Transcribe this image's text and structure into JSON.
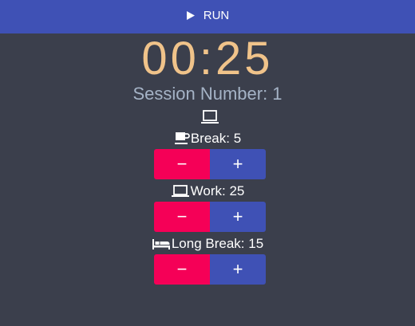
{
  "header": {
    "run_label": "RUN",
    "run_icon": "play-icon",
    "bg_color": "#3f51b5"
  },
  "timer": {
    "display": "00:25",
    "color": "#f0c38a"
  },
  "session": {
    "label": "Session Number: 1"
  },
  "current_mode_icon": "laptop-icon",
  "settings": [
    {
      "icon": "coffee-cup-icon",
      "label": "Break: 5",
      "minus": "−",
      "plus": "+"
    },
    {
      "icon": "laptop-icon",
      "label": "Work: 25",
      "minus": "−",
      "plus": "+"
    },
    {
      "icon": "bed-icon",
      "label": "Long Break: 15",
      "minus": "−",
      "plus": "+"
    }
  ],
  "colors": {
    "background": "#3b3f4c",
    "minus_button": "#f50057",
    "plus_button": "#3f51b5"
  }
}
